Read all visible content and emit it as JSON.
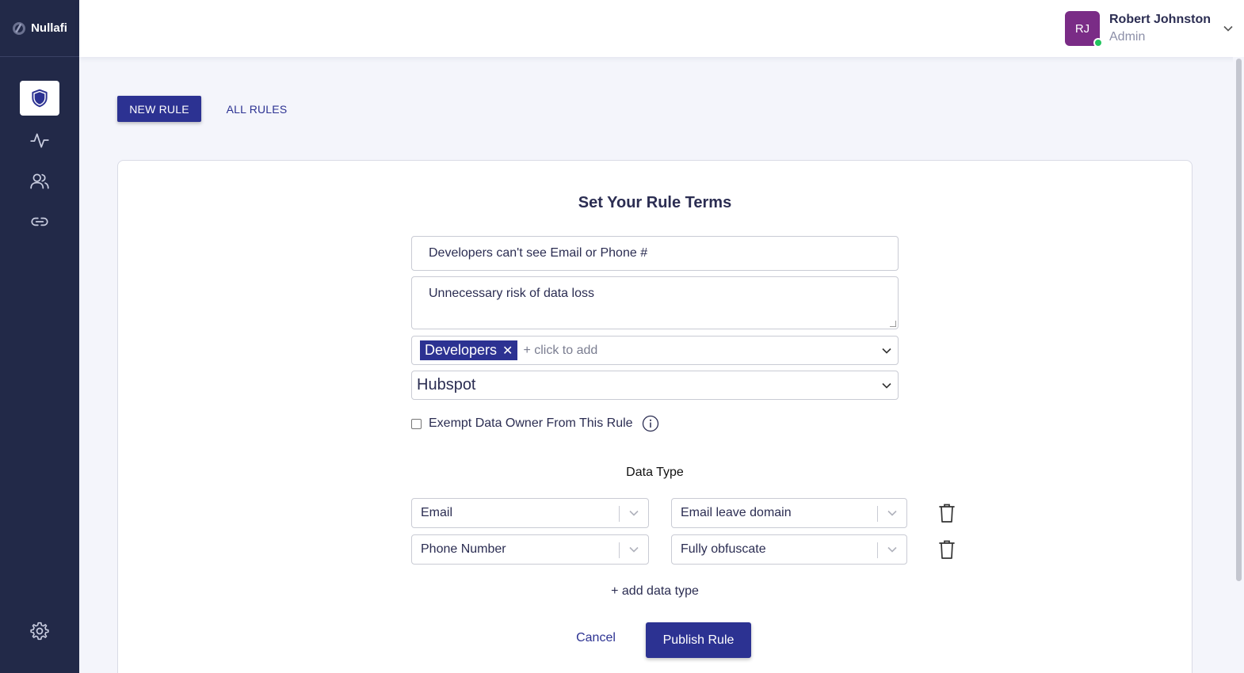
{
  "app": {
    "name": "Nullafi"
  },
  "sidebar": {
    "items": [
      {
        "name": "rules",
        "icon": "shield-icon"
      },
      {
        "name": "activity",
        "icon": "activity-icon"
      },
      {
        "name": "users",
        "icon": "users-icon"
      },
      {
        "name": "integrations",
        "icon": "link-icon"
      },
      {
        "name": "settings",
        "icon": "gear-icon"
      }
    ]
  },
  "user": {
    "initials": "RJ",
    "name": "Robert Johnston",
    "role": "Admin",
    "status": "online"
  },
  "tabs": {
    "new_rule": "NEW RULE",
    "all_rules": "ALL RULES"
  },
  "form": {
    "title": "Set Your Rule Terms",
    "rule_name": "Developers can't see Email or Phone #",
    "reason": "Unnecessary risk of data loss",
    "groups": {
      "chips": [
        "Developers"
      ],
      "add_placeholder": "+ click to add"
    },
    "application": "Hubspot",
    "exempt_label": "Exempt Data Owner From This Rule",
    "exempt_checked": false,
    "data_type_label": "Data Type",
    "data_types": [
      {
        "type": "Email",
        "action": "Email leave domain"
      },
      {
        "type": "Phone Number",
        "action": "Fully obfuscate"
      }
    ],
    "add_data_type": "+ add data type",
    "cancel": "Cancel",
    "publish": "Publish Rule"
  },
  "colors": {
    "primary": "#2c3292",
    "sidebar": "#222948",
    "avatar": "#7a2c86",
    "online": "#22c55e"
  }
}
